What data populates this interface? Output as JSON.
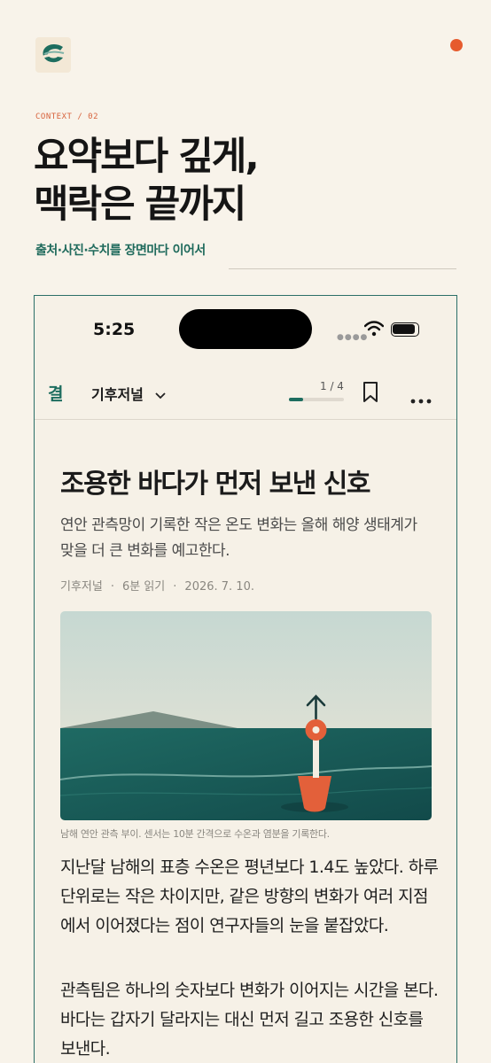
{
  "header": {
    "kicker": "CONTEXT / 02",
    "headline_line1": "요약보다 깊게,",
    "headline_line2": "맥락은 끝까지",
    "subheadline": "출처·사진·수치를 장면마다 이어서"
  },
  "phone": {
    "status_time": "5:25",
    "nav": {
      "brand_mark": "결",
      "journal_name": "기후저널",
      "page_indicator": "1 / 4",
      "reading_progress": 0.25
    },
    "article": {
      "title": "조용한 바다가 먼저 보낸 신호",
      "dek": "연안 관측망이 기록한 작은 온도 변화는 올해 해양 생태계가 맞을 더 큰 변화를 예고한다.",
      "meta_source": "기후저널",
      "meta_read_time": "6분 읽기",
      "meta_date": "2026. 7. 10.",
      "image_caption": "남해 연안 관측 부이. 센서는 10분 간격으로 수온과 염분을 기록한다.",
      "paragraph1": "지난달 남해의 표층 수온은 평년보다 1.4도 높았다. 하루 단위로는 작은 차이지만, 같은 방향의 변화가 여러 지점에서 이어졌다는 점이 연구자들의 눈을 붙잡았다.",
      "paragraph2": "관측팀은 하나의 숫자보다 변화가 이어지는 시간을 본다. 바다는 갑자기 달라지는 대신 먼저 길고 조용한 신호를 보낸다."
    }
  },
  "colors": {
    "accent_orange": "#e65b2e",
    "brand_teal": "#1d6d5f",
    "background": "#f8f3ea"
  },
  "icons": [
    "app-logo-icon",
    "notification-dot-icon",
    "wifi-icon",
    "battery-icon",
    "chevron-down-icon",
    "bookmark-icon",
    "more-icon"
  ]
}
